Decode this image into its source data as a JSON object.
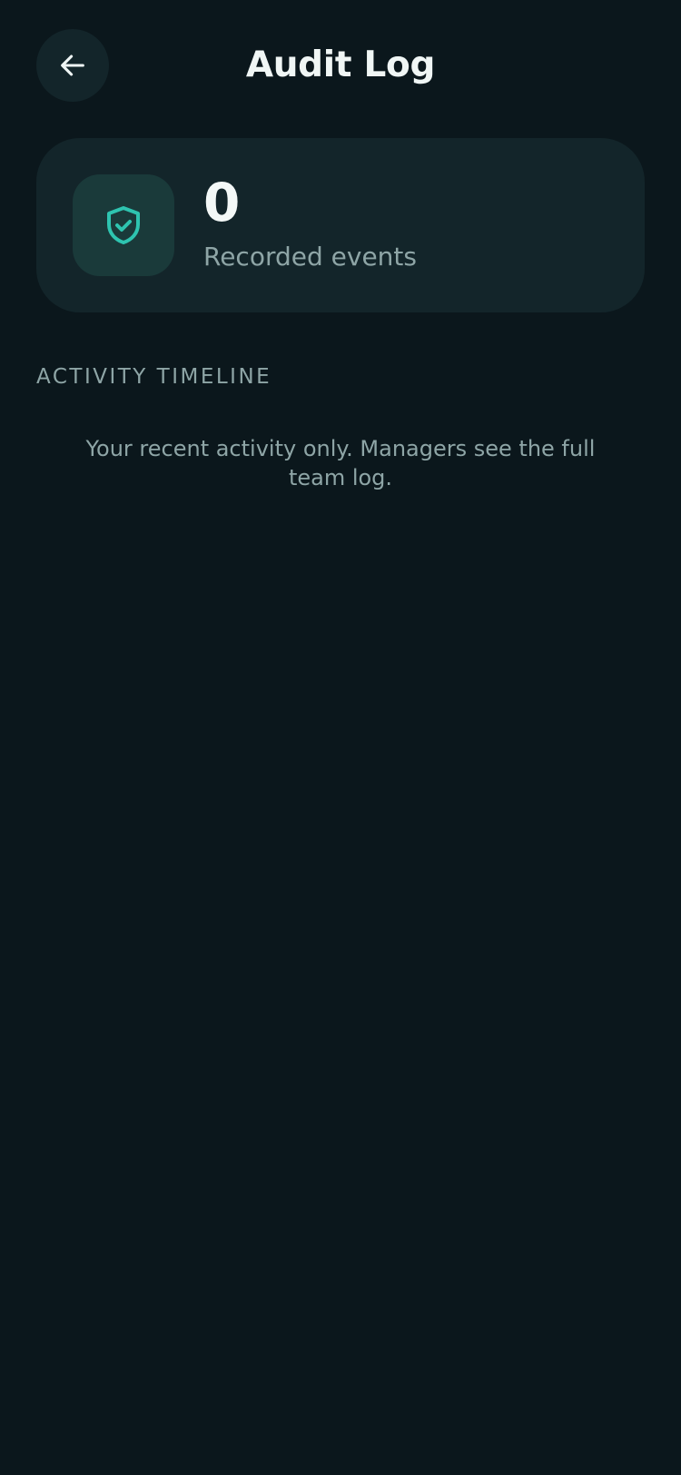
{
  "header": {
    "title": "Audit Log",
    "back_icon": "arrow-left-icon"
  },
  "stats": {
    "count": "0",
    "label": "Recorded events",
    "icon": "shield-check-icon",
    "accent_color": "#2ec4b0"
  },
  "timeline": {
    "heading": "ACTIVITY TIMELINE",
    "empty_message": "Your recent activity only. Managers see the full team log."
  },
  "colors": {
    "background": "#0b171c",
    "card": "#13252a",
    "muted_text": "#8ea5a6",
    "primary_text": "#f0f6f5"
  }
}
